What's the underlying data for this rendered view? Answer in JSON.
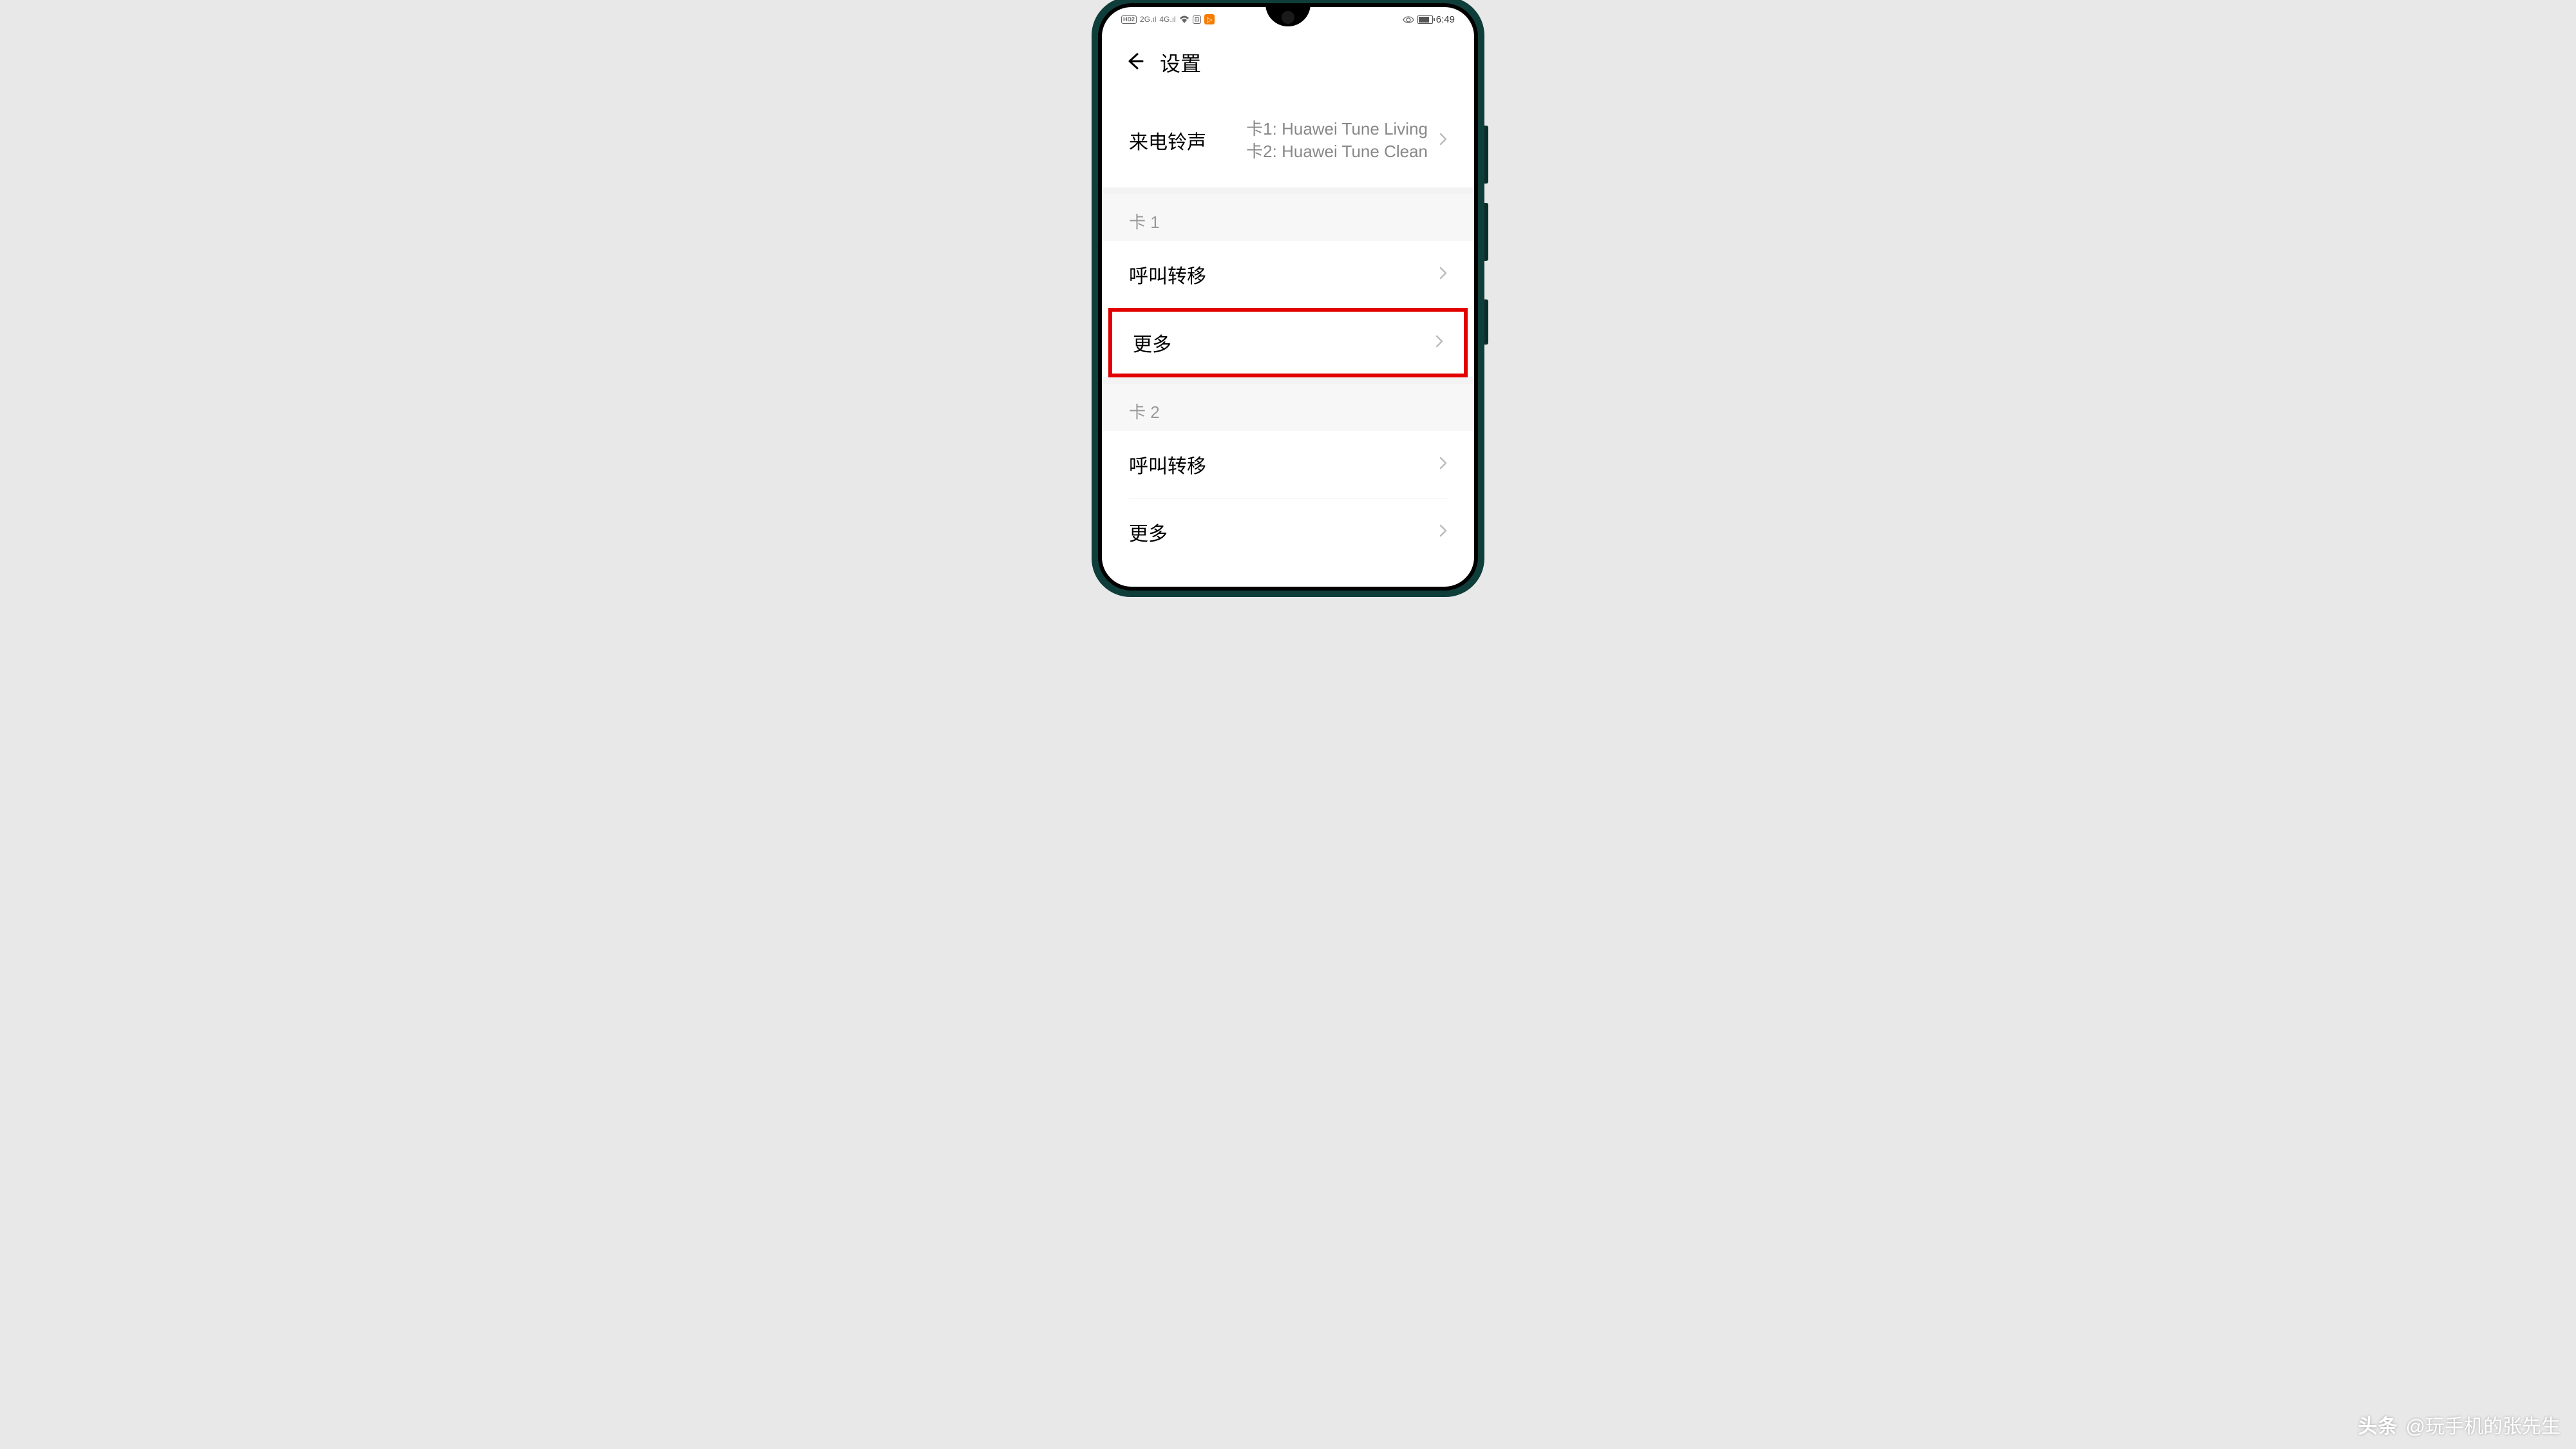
{
  "status": {
    "hd": "HD2",
    "net1": "2G",
    "net2": "4G",
    "time": "6:49"
  },
  "header": {
    "title": "设置"
  },
  "ringtone": {
    "label": "来电铃声",
    "sim1": "卡1: Huawei Tune Living",
    "sim2": "卡2: Huawei Tune Clean"
  },
  "section1": {
    "title": "卡 1",
    "forward": "呼叫转移",
    "more": "更多"
  },
  "section2": {
    "title": "卡 2",
    "forward": "呼叫转移",
    "more": "更多"
  },
  "watermark": {
    "brand": "头条",
    "author": "@玩手机的张先生"
  }
}
